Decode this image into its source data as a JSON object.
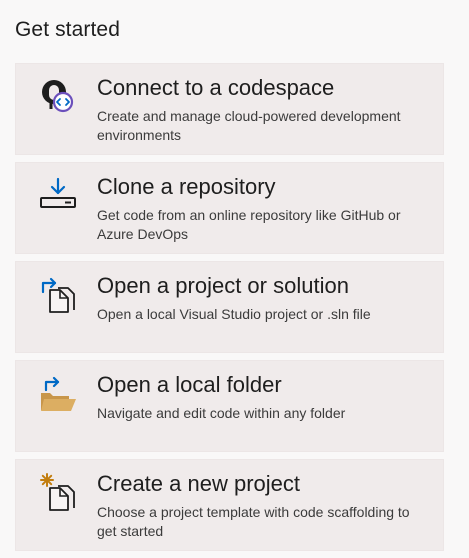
{
  "heading": "Get started",
  "cards": [
    {
      "title": "Connect to a codespace",
      "description": "Create and manage cloud-powered development environments",
      "icon": "codespace-icon"
    },
    {
      "title": "Clone a repository",
      "description": "Get code from an online repository like GitHub or Azure DevOps",
      "icon": "clone-download-icon"
    },
    {
      "title": "Open a project or solution",
      "description": "Open a local Visual Studio project or .sln file",
      "icon": "open-project-icon"
    },
    {
      "title": "Open a local folder",
      "description": "Navigate and edit code within any folder",
      "icon": "open-folder-icon"
    },
    {
      "title": "Create a new project",
      "description": "Choose a project template with code scaffolding to get started",
      "icon": "new-project-icon"
    }
  ],
  "colors": {
    "card_background": "#f0ebeb",
    "accent_blue": "#0069c5",
    "folder_tan": "#dcae62",
    "sparkle_orange": "#c27d0e",
    "text": "#1e1e1e"
  }
}
